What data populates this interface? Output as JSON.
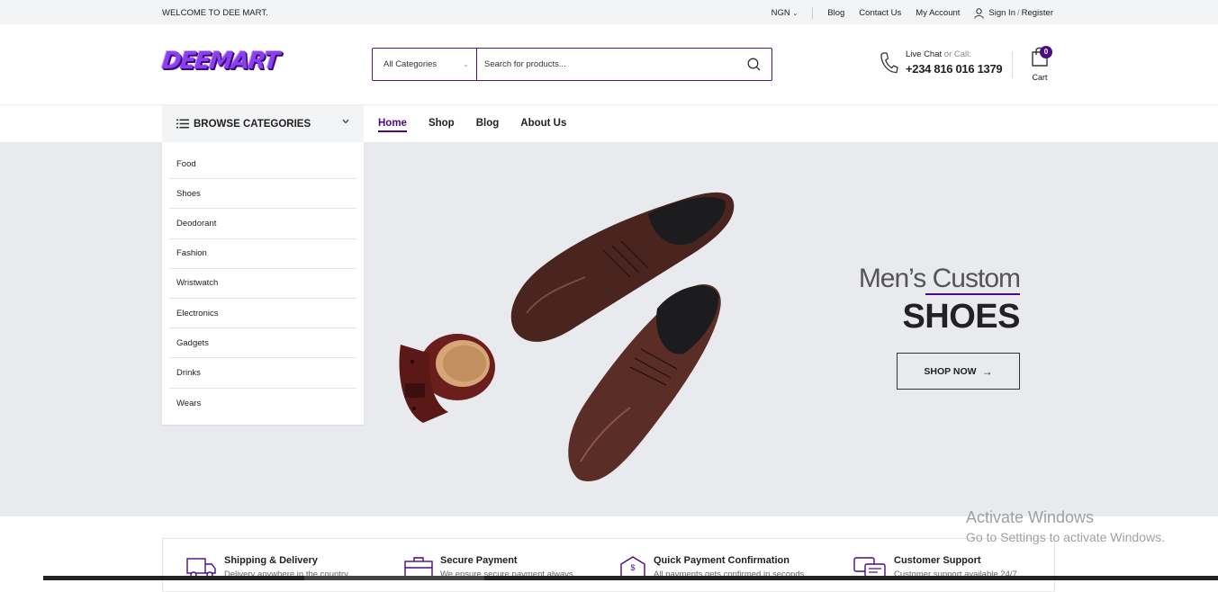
{
  "topbar": {
    "welcome": "WELCOME TO DEE MART.",
    "currency": "NGN",
    "links": [
      "Blog",
      "Contact Us",
      "My Account"
    ],
    "sign_in": "Sign In",
    "slash": "/",
    "register": "Register"
  },
  "header": {
    "logo_text": "DEEMART",
    "search": {
      "category": "All Categories",
      "placeholder": "Search for products..."
    },
    "contact": {
      "live_chat": "Live Chat",
      "or_call": "or Call:",
      "phone": "+234 816 016 1379"
    },
    "cart": {
      "count": "0",
      "label": "Cart"
    }
  },
  "nav": {
    "browse_label": "BROWSE CATEGORIES",
    "items": [
      "Home",
      "Shop",
      "Blog",
      "About Us"
    ],
    "active": "Home"
  },
  "categories": [
    "Food",
    "Shoes",
    "Deodorant",
    "Fashion",
    "Wristwatch",
    "Electronics",
    "Gadgets",
    "Drinks",
    "Wears"
  ],
  "banner": {
    "line1_a": "Men’s",
    "line1_b": " Custom",
    "line2": "SHOES",
    "cta": "SHOP NOW",
    "cta_arrow": "→"
  },
  "features": [
    {
      "title": "Shipping & Delivery",
      "desc": "Delivery anywhere in the country"
    },
    {
      "title": "Secure Payment",
      "desc": "We ensure secure payment always"
    },
    {
      "title": "Quick Payment Confirmation",
      "desc": "All payments gets confirmed in seconds"
    },
    {
      "title": "Customer Support",
      "desc": "Customer support available 24/7"
    }
  ],
  "watermark": {
    "line1": "Activate Windows",
    "line2": "Go to Settings to activate Windows."
  },
  "colors": {
    "brand": "#4b0a86",
    "hero_bg": "#e8eaee",
    "topbar_bg": "#f3f4f6"
  }
}
